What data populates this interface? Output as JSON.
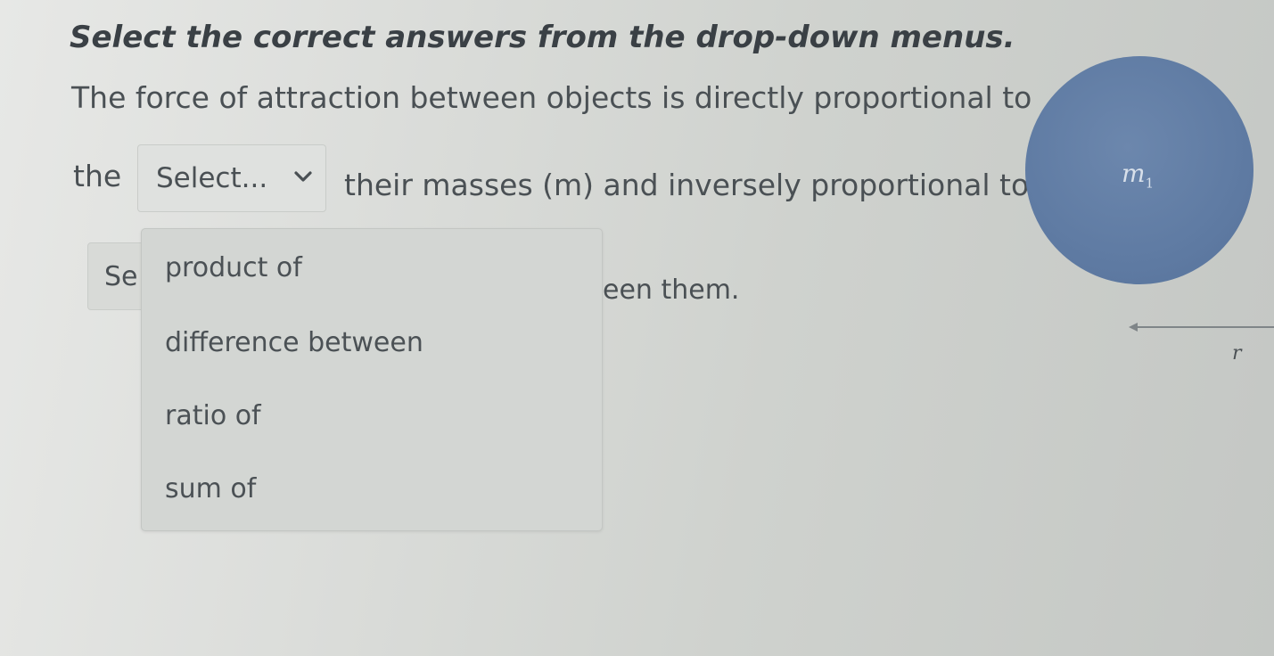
{
  "instruction": "Select the correct answers from the drop-down menus.",
  "sentence": {
    "line1": "The force of attraction between objects is  directly  proportional to",
    "line2_prefix": "the",
    "line2_suffix": "their masses (m) and inversely proportional to the",
    "line3_tail": "een them."
  },
  "dropdown1": {
    "selected": "Select...",
    "options": [
      "product of",
      "difference between",
      "ratio of",
      "sum of"
    ]
  },
  "dropdown2": {
    "visible_text": "Se"
  },
  "diagram": {
    "mass_label": "m",
    "mass_subscript": "1",
    "distance_label": "r",
    "circle_color": "#5f7ba3"
  }
}
